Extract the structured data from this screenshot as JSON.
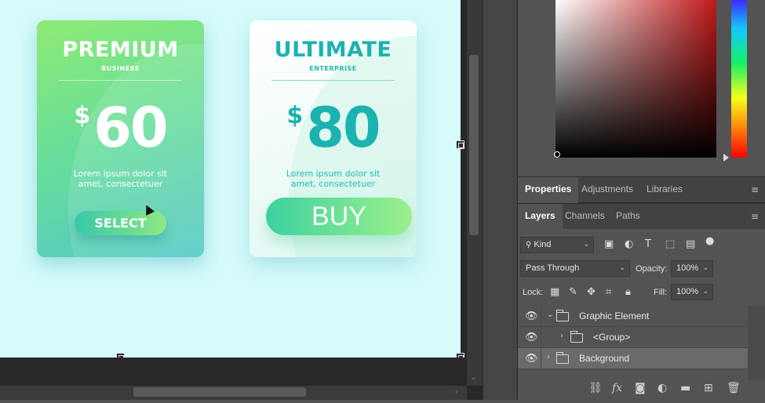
{
  "canvas": {
    "cards": {
      "premium": {
        "title": "PREMIUM",
        "subtitle": "BUSINESS",
        "currency": "$",
        "amount": "60",
        "description": "Lorem ipsum dolor sit amet, consectetuer",
        "button_label": "SELECT"
      },
      "ultimate": {
        "title": "ULTIMATE",
        "subtitle": "ENTERPRISE",
        "currency": "$",
        "amount": "80",
        "description": "Lorem ipsum dolor sit amet, consectetuer",
        "button_label": "BUY"
      }
    },
    "colors": {
      "canvas_bg": "#d6fbfb",
      "premium_gradient_start": "#8eeb74",
      "premium_gradient_end": "#52c8c6",
      "ultimate_accent": "#1ab3b0"
    }
  },
  "properties_panel": {
    "tabs": [
      {
        "label": "Properties",
        "active": true
      },
      {
        "label": "Adjustments",
        "active": false
      },
      {
        "label": "Libraries",
        "active": false
      }
    ],
    "menu_icon": "hamburger-icon"
  },
  "layers_panel": {
    "tabs": [
      {
        "label": "Layers",
        "active": true
      },
      {
        "label": "Channels",
        "active": false
      },
      {
        "label": "Paths",
        "active": false
      }
    ],
    "filter": {
      "value": "Kind",
      "icon": "search-icon"
    },
    "blend_mode": "Pass Through",
    "opacity_label": "Opacity:",
    "opacity_value": "100%",
    "lock_label": "Lock:",
    "fill_label": "Fill:",
    "fill_value": "100%",
    "layers": [
      {
        "name": "Graphic Element",
        "expanded": true,
        "selected": false
      },
      {
        "name": "<Group>",
        "expanded": false,
        "selected": false
      },
      {
        "name": "Background",
        "expanded": false,
        "selected": true
      }
    ],
    "footer_icons": [
      "link-icon",
      "fx-icon",
      "mask-icon",
      "adjustment-icon",
      "folder-icon",
      "new-layer-icon",
      "trash-icon"
    ]
  }
}
